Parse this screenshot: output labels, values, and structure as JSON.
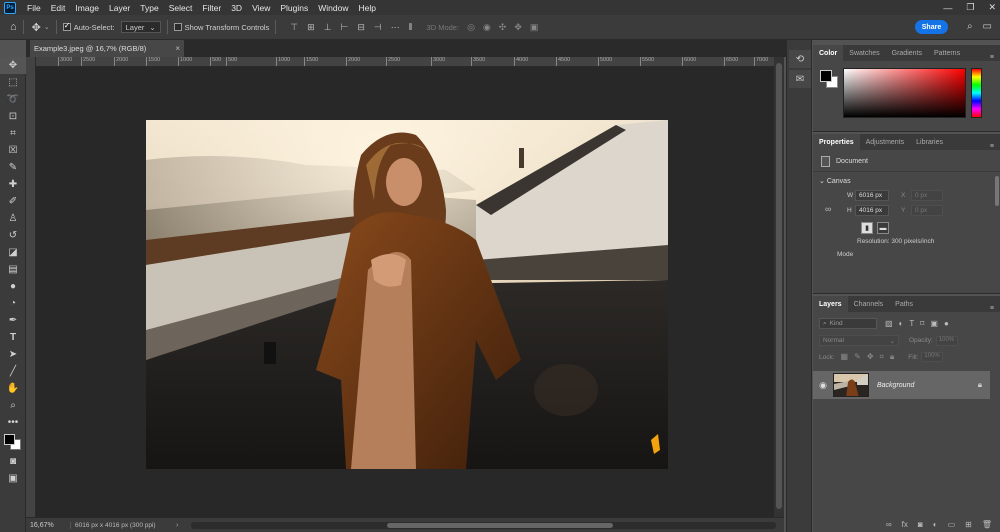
{
  "app": {
    "logo": "Ps"
  },
  "menu": [
    "File",
    "Edit",
    "Image",
    "Layer",
    "Type",
    "Select",
    "Filter",
    "3D",
    "View",
    "Plugins",
    "Window",
    "Help"
  ],
  "window_controls": [
    "—",
    "❐",
    "✕"
  ],
  "options": {
    "auto_select_label": "Auto-Select:",
    "auto_select_value": "Layer",
    "transform_label": "Show Transform Controls",
    "mode3d_label": "3D Mode:",
    "share_label": "Share"
  },
  "document": {
    "tab_title": "Example3.jpeg @ 16,7% (RGB/8)",
    "close": "×"
  },
  "ruler": [
    "3000",
    "2500",
    "2000",
    "1500",
    "1000",
    "500",
    "0",
    "500",
    "1000",
    "1500",
    "2000",
    "2500",
    "3000",
    "3500",
    "4000",
    "4500",
    "5000",
    "5500",
    "6000",
    "6500",
    "7000"
  ],
  "status": {
    "zoom": "16,67%",
    "doc_info": "6016 px x 4016 px (300 ppi)",
    "arrow": "›"
  },
  "color_panel": {
    "tabs": [
      "Color",
      "Swatches",
      "Gradients",
      "Patterns"
    ],
    "foreground": "#000000",
    "background": "#ffffff"
  },
  "properties_panel": {
    "tabs": [
      "Properties",
      "Adjustments",
      "Libraries"
    ],
    "doc_label": "Document",
    "section": "Canvas",
    "w_label": "W",
    "w_value": "6016 px",
    "h_label": "H",
    "h_value": "4016 px",
    "x_label": "X",
    "x_value": "0 px",
    "y_label": "Y",
    "y_value": "0 px",
    "resolution": "Resolution: 300 pixels/inch",
    "mode_label": "Mode"
  },
  "layers_panel": {
    "tabs": [
      "Layers",
      "Channels",
      "Paths"
    ],
    "kind_label": "Kind",
    "blend_mode": "Normal",
    "opacity_label": "Opacity:",
    "opacity_value": "100%",
    "lock_label": "Lock:",
    "fill_label": "Fill:",
    "fill_value": "100%",
    "layer_name": "Background"
  },
  "colors": {
    "accent": "#1473e6",
    "panel": "#474747",
    "workspace": "#282828"
  }
}
